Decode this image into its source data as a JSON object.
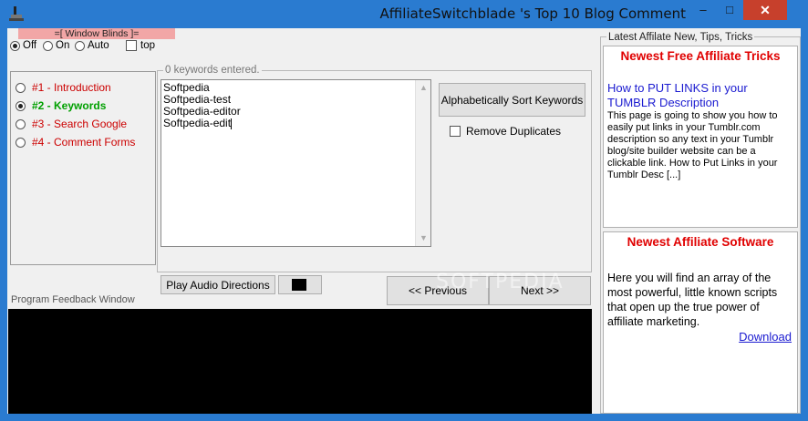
{
  "window": {
    "title": "AffiliateSwitchblade 's Top 10 Blog Comment",
    "minimize": "–",
    "maximize": "□",
    "close": "✕"
  },
  "blinds": {
    "header": "=[ Window Blinds ]=",
    "options": [
      "Off",
      "On",
      "Auto"
    ],
    "selected": "Off",
    "top_label": "top"
  },
  "steps": [
    {
      "label": "#1 - Introduction",
      "color": "#cc0000",
      "selected": false
    },
    {
      "label": "#2 - Keywords",
      "color": "#00a000",
      "selected": true
    },
    {
      "label": "#3 - Search Google",
      "color": "#cc0000",
      "selected": false
    },
    {
      "label": "#4 - Comment Forms",
      "color": "#cc0000",
      "selected": false
    }
  ],
  "keywords": {
    "count_label": "0 keywords entered.",
    "lines": [
      "Softpedia",
      "Softpedia-test",
      "Softpedia-editor",
      "Softpedia-edit"
    ],
    "sort_button": "Alphabetically Sort Keywords",
    "remove_duplicates": "Remove Duplicates"
  },
  "controls": {
    "audio_button": "Play Audio Directions",
    "prev_button": "<< Previous",
    "next_button": "Next >>",
    "watermark": "SOFTPEDIA",
    "feedback_label": "Program Feedback Window"
  },
  "sidebar": {
    "legend": "Latest Affilate New, Tips, Tricks",
    "panel1": {
      "title": "Newest Free Affiliate Tricks",
      "link": "How to PUT LINKS in your TUMBLR Description",
      "text": "This page is going to show you how to easily put links in your Tumblr.com description so any text in your Tumblr blog/site builder website can be a clickable link. How to Put Links in your Tumblr Desc [...]"
    },
    "panel2": {
      "title": "Newest Affiliate Software",
      "text": "Here you will find an array of the most powerful, little known scripts that open up the true power of affiliate marketing.",
      "download": "Download"
    }
  }
}
